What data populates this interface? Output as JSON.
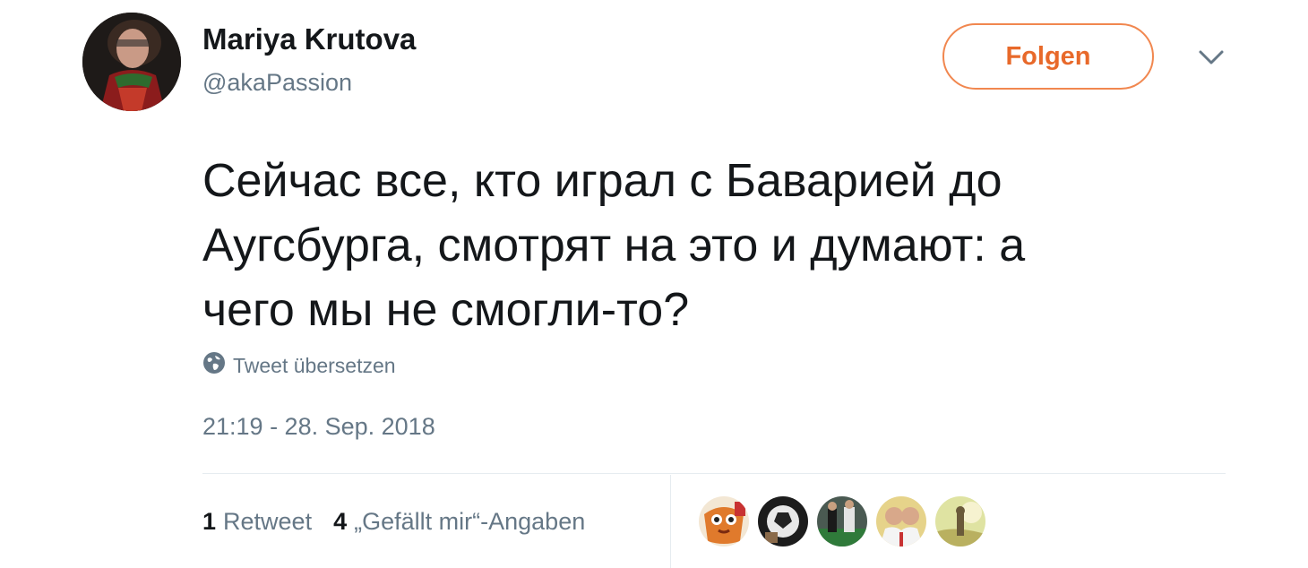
{
  "author": {
    "display_name": "Mariya Krutova",
    "handle": "@akaPassion"
  },
  "follow_button": {
    "label": "Folgen"
  },
  "tweet": {
    "lines": [
      "Сейчас все, кто играл с Баварией до",
      "Аугсбурга, смотрят на это и думают: а",
      "чего мы не смогли-то?"
    ],
    "translate_label": "Tweet übersetzen",
    "timestamp": "21:19 - 28. Sep. 2018"
  },
  "stats": {
    "retweet_count": "1",
    "retweet_label": "Retweet",
    "likes_count": "4",
    "likes_label": "„Gefällt mir“-Angaben"
  },
  "likers": [
    {
      "icon": "liker-avatar"
    },
    {
      "icon": "liker-avatar"
    },
    {
      "icon": "liker-avatar"
    },
    {
      "icon": "liker-avatar"
    },
    {
      "icon": "liker-avatar"
    }
  ],
  "colors": {
    "accent": "#e8692a",
    "accent_border": "#f1874f",
    "secondary_text": "#657786",
    "primary_text": "#14171a",
    "divider": "#e6ecf0"
  },
  "icons": {
    "globe": "globe-icon",
    "chevron": "chevron-down-icon"
  }
}
